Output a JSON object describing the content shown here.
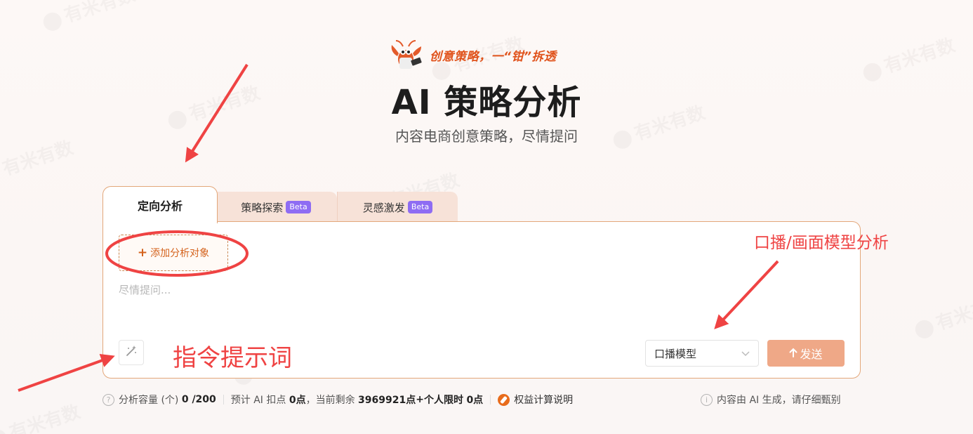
{
  "header": {
    "slogan": "创意策略，一“钳”拆透",
    "title": "AI 策略分析",
    "subtitle": "内容电商创意策略，尽情提问"
  },
  "tabs": [
    {
      "label": "定向分析",
      "active": true
    },
    {
      "label": "策略探索",
      "badge": "Beta",
      "active": false
    },
    {
      "label": "灵感激发",
      "badge": "Beta",
      "active": false
    }
  ],
  "panel": {
    "add_target_label": "添加分析对象",
    "prompt_placeholder": "尽情提问...",
    "model_select_value": "口播模型",
    "send_label": "发送"
  },
  "footer": {
    "capacity_label": "分析容量 (个)",
    "capacity_value": "0 /200",
    "estimate_prefix": "预计 AI 扣点",
    "estimate_value": "0点",
    "remaining_prefix": "，当前剩余",
    "remaining_value": "3969921点",
    "plus": "+",
    "personal_label": "个人限时",
    "personal_value": "0点",
    "rights_label": "权益计算说明",
    "disclaimer": "内容由 AI 生成，请仔细甄别"
  },
  "watermark": "有米有数",
  "annotations": {
    "model_note": "口播/画面模型分析",
    "prompt_note": "指令提示词"
  },
  "colors": {
    "accent": "#e0531c",
    "panel_border": "#e3a77a",
    "send_button": "#efa887",
    "beta_badge": "#8e6cf3",
    "annotation_red": "#ef4343"
  }
}
